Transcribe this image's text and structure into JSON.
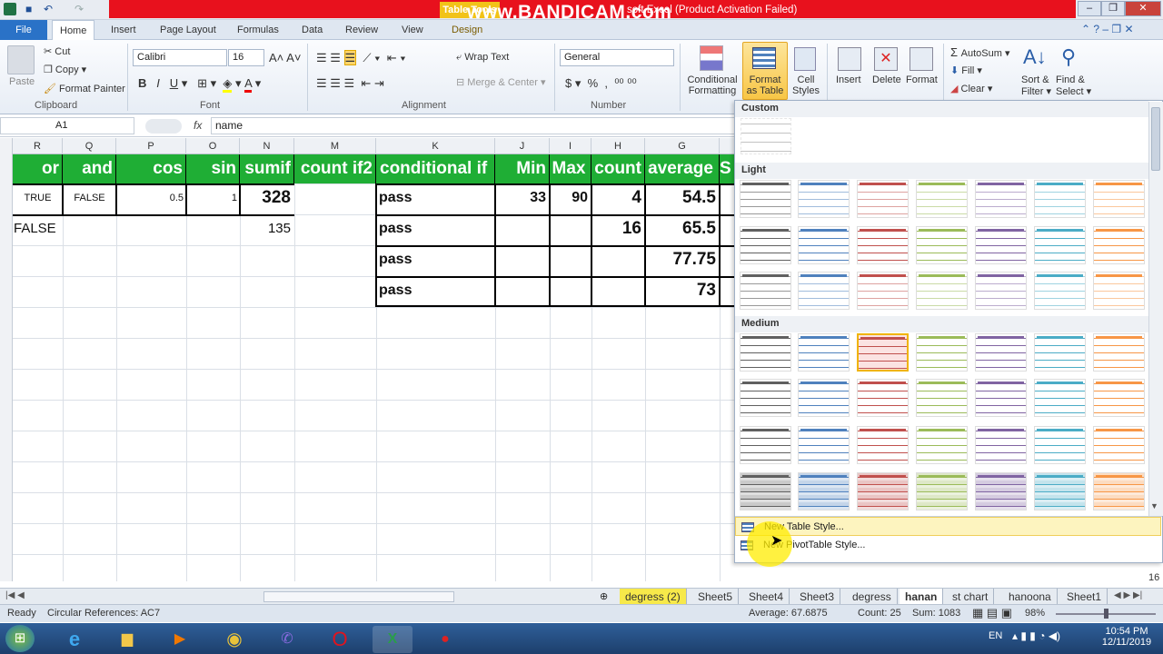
{
  "title_bar": {
    "context_tab": "Table Tools",
    "watermark": "www.BANDICAM.com",
    "title_rest": "soft Excel (Product Activation Failed)"
  },
  "tabs": [
    "File",
    "Home",
    "Insert",
    "Page Layout",
    "Formulas",
    "Data",
    "Review",
    "View",
    "Design"
  ],
  "ribbon": {
    "clipboard": {
      "paste": "Paste",
      "cut": "Cut",
      "copy": "Copy",
      "format_painter": "Format Painter",
      "label": "Clipboard"
    },
    "font": {
      "name": "Calibri",
      "size": "16",
      "label": "Font"
    },
    "alignment": {
      "wrap_text": "Wrap Text",
      "merge_center": "Merge & Center",
      "label": "Alignment"
    },
    "number": {
      "format": "General",
      "label": "Number"
    },
    "styles": {
      "conditional": "Conditional",
      "conditional2": "Formatting",
      "format_table": "Format",
      "format_table2": "as Table",
      "cell_styles": "Cell",
      "cell_styles2": "Styles"
    },
    "cells": {
      "insert": "Insert",
      "delete": "Delete",
      "format": "Format"
    },
    "editing": {
      "autosum": "AutoSum",
      "fill": "Fill",
      "clear": "Clear",
      "sort": "Sort &",
      "sort2": "Filter",
      "find": "Find &",
      "find2": "Select"
    }
  },
  "formula_bar": {
    "name_box": "A1",
    "fx": "fx",
    "value": "name"
  },
  "columns": [
    "R",
    "Q",
    "P",
    "O",
    "N",
    "M",
    "K",
    "J",
    "I",
    "H",
    "G"
  ],
  "sheet": {
    "headers": [
      "or",
      "and",
      "cos",
      "sin",
      "sumif",
      "count if2",
      "conditional if",
      "Min",
      "Max",
      "count",
      "average",
      "S"
    ],
    "row1": {
      "or": "TRUE",
      "and": "FALSE",
      "cos": "0.5",
      "sin": "1",
      "sumif": "328",
      "k": "pass",
      "min": "33",
      "max": "90",
      "count": "4",
      "average": "54.5"
    },
    "row2": {
      "or": "FALSE",
      "sumif": "135",
      "k": "pass",
      "count": "16",
      "average": "65.5"
    },
    "row3": {
      "k": "pass",
      "average": "77.75"
    },
    "row4": {
      "k": "pass",
      "average": "73"
    }
  },
  "gallery": {
    "sections": [
      "Custom",
      "Light",
      "Medium"
    ],
    "new_table_style": "New Table Style...",
    "new_pivot_style": "New PivotTable Style...",
    "colors": [
      "#606060",
      "#4f81bd",
      "#c0504d",
      "#9bbb59",
      "#8064a2",
      "#4bacc6",
      "#f79646"
    ]
  },
  "sheet_tabs": [
    "degress (2)",
    "Sheet5",
    "Sheet4",
    "Sheet3",
    "degress",
    "hanan",
    "st chart",
    "hanoona",
    "Sheet1"
  ],
  "row_number_tail": "16",
  "status": {
    "ready": "Ready",
    "circular": "Circular References: AC7",
    "average": "Average: 67.6875",
    "count": "Count: 25",
    "sum": "Sum: 1083",
    "zoom": "98%"
  },
  "taskbar": {
    "lang": "EN",
    "time": "10:54 PM",
    "date": "12/11/2019"
  }
}
